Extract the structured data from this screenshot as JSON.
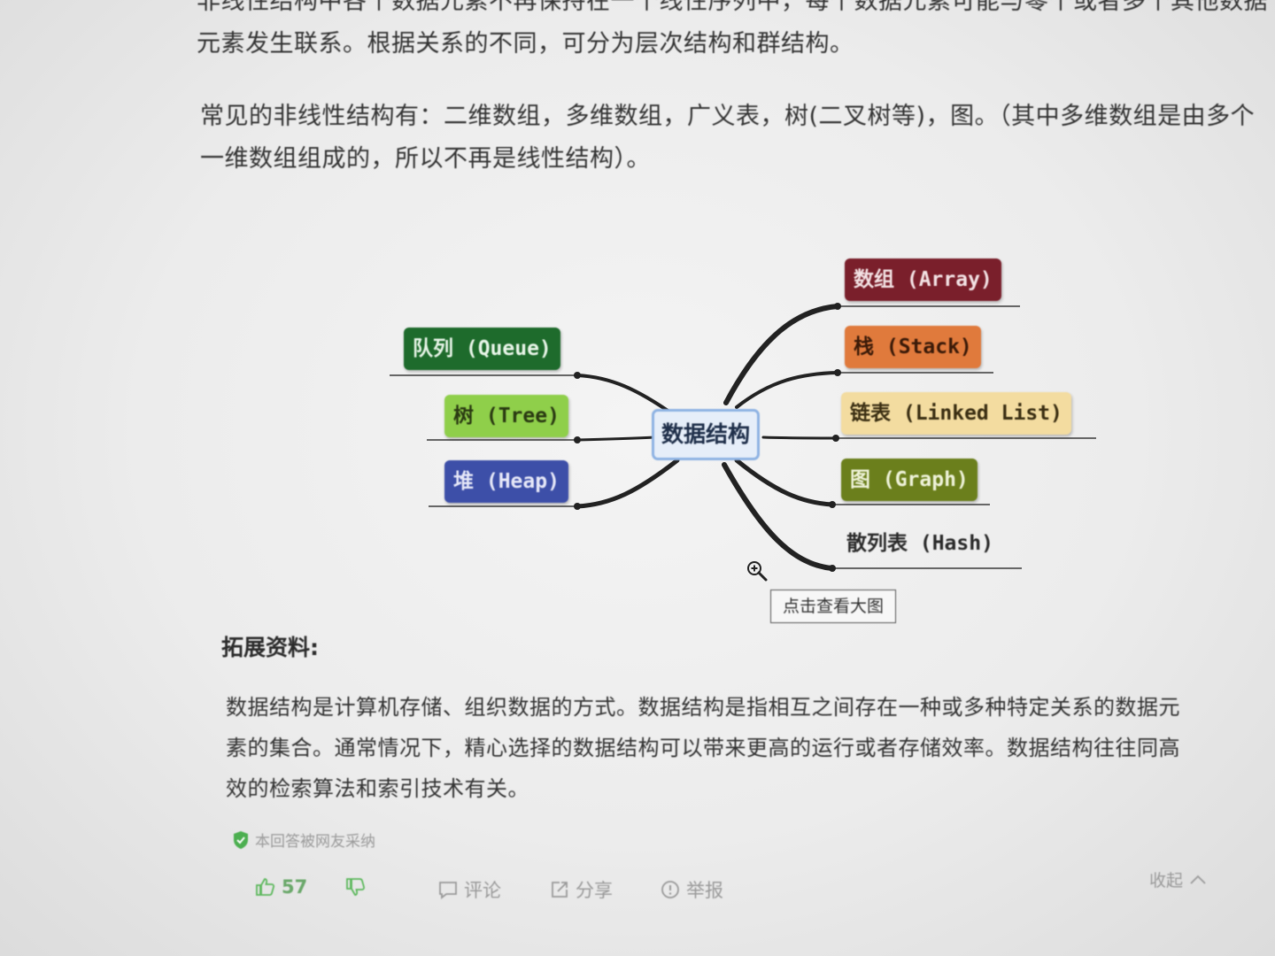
{
  "article": {
    "intro_line1": "非线性结构中各个数据元素不再保持在一个线性序列中，每个数据元素可能与零个或者多个其他数据",
    "intro_line2": "元素发生联系。根据关系的不同，可分为层次结构和群结构。",
    "common_line1": "常见的非线性结构有：二维数组，多维数组，广义表，树(二叉树等)，图。（其中多维数组是由多个",
    "common_line2": "一维数组组成的，所以不再是线性结构）。"
  },
  "mindmap": {
    "center": "数据结构",
    "left_nodes": [
      {
        "label": "队列 (Queue)",
        "color": "#1e6b2c",
        "text_color": "#e8f5e8"
      },
      {
        "label": "树 (Tree)",
        "color": "#8fcf4a",
        "text_color": "#2a3a12"
      },
      {
        "label": "堆 (Heap)",
        "color": "#3d4fa8",
        "text_color": "#e6e8f8"
      }
    ],
    "right_nodes": [
      {
        "label": "数组 (Array)",
        "color": "#7a1f2b",
        "text_color": "#f3e2e4"
      },
      {
        "label": "栈 (Stack)",
        "color": "#e07a3c",
        "text_color": "#3a1a08"
      },
      {
        "label": "链表 (Linked List)",
        "color": "#f3dca0",
        "text_color": "#3a2e12"
      },
      {
        "label": "图 (Graph)",
        "color": "#6b7f1c",
        "text_color": "#eef2d8"
      },
      {
        "label": "散列表 (Hash)",
        "color": "#f0f0f0",
        "text_color": "#2a2a2a"
      }
    ],
    "zoom_hint": "点击查看大图"
  },
  "extension": {
    "heading": "拓展资料:",
    "line1": "数据结构是计算机存储、组织数据的方式。数据结构是指相互之间存在一种或多种特定关系的数据元",
    "line2": "素的集合。通常情况下，精心选择的数据结构可以带来更高的运行或者存储效率。数据结构往往同高",
    "line3": "效的检索算法和索引技术有关。"
  },
  "footer": {
    "accepted_text": "本回答被网友采纳",
    "like_count": "57",
    "comment_label": "评论",
    "share_label": "分享",
    "report_label": "举报",
    "collapse_label": "收起",
    "accent_green": "#5cb85c"
  }
}
